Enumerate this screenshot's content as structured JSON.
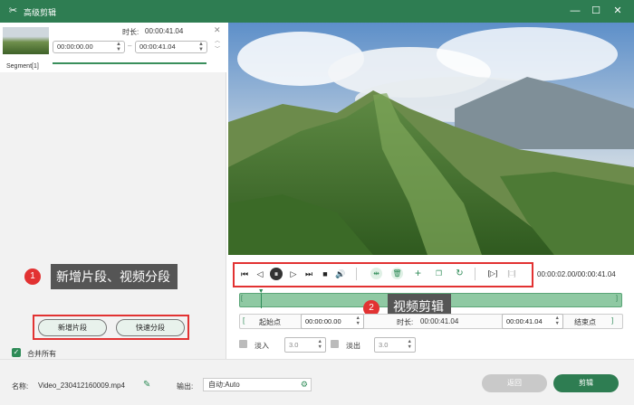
{
  "window": {
    "title": "高级剪辑"
  },
  "segment": {
    "duration_label": "时长:",
    "duration_value": "00:00:41.04",
    "start_time": "00:00:00.00",
    "end_time": "00:00:41.04",
    "label": "Segment[1]"
  },
  "left_panel": {
    "add_segment_button": "新增片段",
    "quick_split_button": "快速分段",
    "merge_all_label": "合并所有",
    "merge_all_checked": true
  },
  "callouts": [
    {
      "number": "1",
      "text": "新增片段、视频分段"
    },
    {
      "number": "2",
      "text": "视频剪辑"
    }
  ],
  "player": {
    "time_display": "00:00:02.00/00:00:41.04"
  },
  "trim": {
    "start_point_label": "起始点",
    "start_value": "00:00:00.00",
    "duration_label": "时长:",
    "duration_value": "00:00:41.04",
    "end_value": "00:00:41.04",
    "end_point_label": "结束点",
    "playhead_fraction": 0.049
  },
  "fade": {
    "fade_in_label": "淡入",
    "fade_in_value": "3.0",
    "fade_out_label": "淡出",
    "fade_out_value": "3.0"
  },
  "footer": {
    "name_label": "名称:",
    "file_name": "Video_230412160009.mp4",
    "output_label": "输出:",
    "output_value": "自动:Auto",
    "back_button": "返回",
    "edit_button": "剪辑"
  },
  "colors": {
    "brand": "#2e7d52",
    "callout_red": "#e23232"
  }
}
